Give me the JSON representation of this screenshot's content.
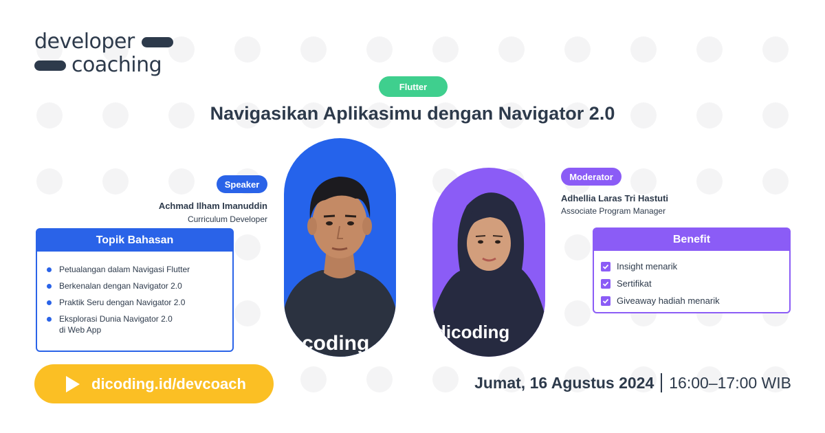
{
  "logo": {
    "line1": "developer",
    "line2": "coaching"
  },
  "category_tag": "Flutter",
  "title": "Navigasikan Aplikasimu dengan Navigator 2.0",
  "speaker": {
    "tag": "Speaker",
    "name": "Achmad Ilham Imanuddin",
    "role": "Curriculum Developer",
    "shirt_text": "coding"
  },
  "moderator": {
    "tag": "Moderator",
    "name": "Adhellia Laras Tri Hastuti",
    "role": "Associate Program Manager",
    "shirt_text": "dicoding"
  },
  "topics": {
    "heading": "Topik Bahasan",
    "items": [
      "Petualangan dalam Navigasi Flutter",
      "Berkenalan dengan Navigator 2.0",
      "Praktik Seru dengan Navigator 2.0",
      "Eksplorasi Dunia Navigator 2.0\ndi Web App"
    ]
  },
  "benefit": {
    "heading": "Benefit",
    "items": [
      "Insight menarik",
      "Sertifikat",
      "Giveaway hadiah menarik"
    ]
  },
  "cta": {
    "text": "dicoding.id/devcoach",
    "icon": "play-icon"
  },
  "schedule": {
    "date": "Jumat, 16 Agustus 2024",
    "time": "16:00–17:00 WIB"
  },
  "colors": {
    "blue": "#2a63e8",
    "purple": "#8b5cf6",
    "green": "#3fcf8e",
    "yellow": "#fbbf24",
    "navy": "#2d3a4b"
  }
}
